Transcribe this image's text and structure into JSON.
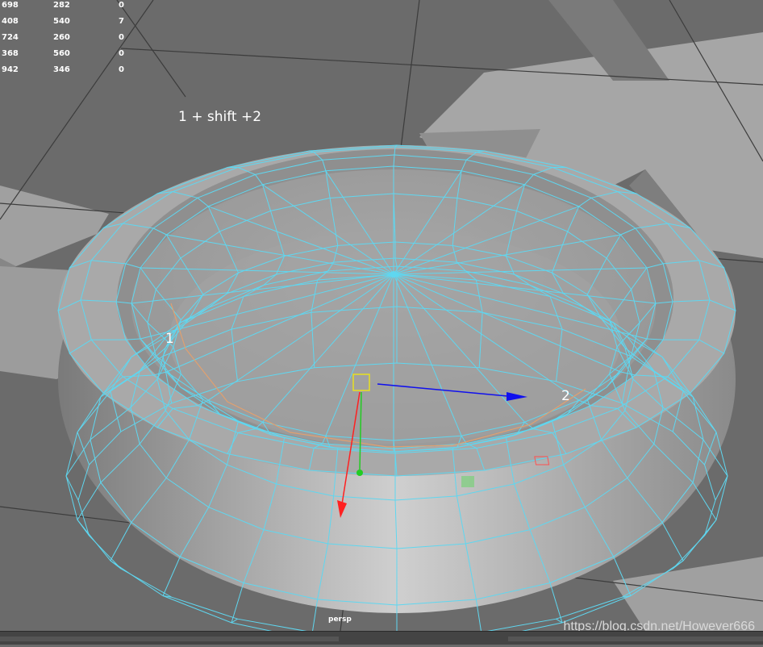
{
  "stats": {
    "rows": [
      [
        "698",
        "282",
        "0"
      ],
      [
        "408",
        "540",
        "7"
      ],
      [
        "724",
        "260",
        "0"
      ],
      [
        "368",
        "560",
        "0"
      ],
      [
        "942",
        "346",
        "0"
      ]
    ]
  },
  "viewport": {
    "hint_text": "1 + shift +2",
    "edge_label_1": "1",
    "edge_label_2": "2",
    "camera_label": "persp"
  },
  "watermark": "https://blog.csdn.net/However666",
  "colors": {
    "background": "#6b6b6b",
    "wireframe": "#5fd7f0",
    "selected_edge": "#e0a070",
    "axis_x": "#ff2020",
    "axis_y": "#22cc22",
    "axis_z": "#1010ee",
    "pivot_handle": "#e8e020"
  },
  "icons": [
    "move-tool-manipulator",
    "scale-handle-icon"
  ]
}
